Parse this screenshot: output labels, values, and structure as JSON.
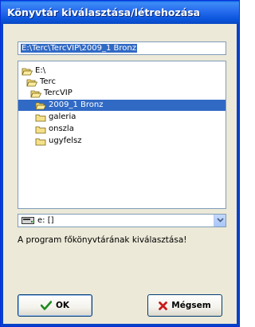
{
  "window": {
    "title": "Könyvtár kiválasztása/létrehozása"
  },
  "path_input": {
    "value": "E:\\Terc\\TercVIP\\2009_1 Bronz"
  },
  "tree": {
    "items": [
      {
        "label": "E:\\",
        "icon": "open-folder-icon"
      },
      {
        "label": "Terc",
        "icon": "open-folder-icon"
      },
      {
        "label": "TercVIP",
        "icon": "open-folder-icon"
      },
      {
        "label": "2009_1 Bronz",
        "icon": "open-folder-icon",
        "selected": true
      },
      {
        "label": "galeria",
        "icon": "folder-icon"
      },
      {
        "label": "onszla",
        "icon": "folder-icon"
      },
      {
        "label": "ugyfelsz",
        "icon": "folder-icon"
      }
    ]
  },
  "drive_select": {
    "value": "e: []",
    "icon": "drive-icon"
  },
  "status": {
    "text": "A program főkönyvtárának kiválasztása!"
  },
  "buttons": {
    "ok_label": "OK",
    "cancel_label": "Mégsem"
  },
  "colors": {
    "titlebar": "#0a55dc",
    "selection": "#316ac5",
    "dialog_bg": "#ece9d8"
  }
}
